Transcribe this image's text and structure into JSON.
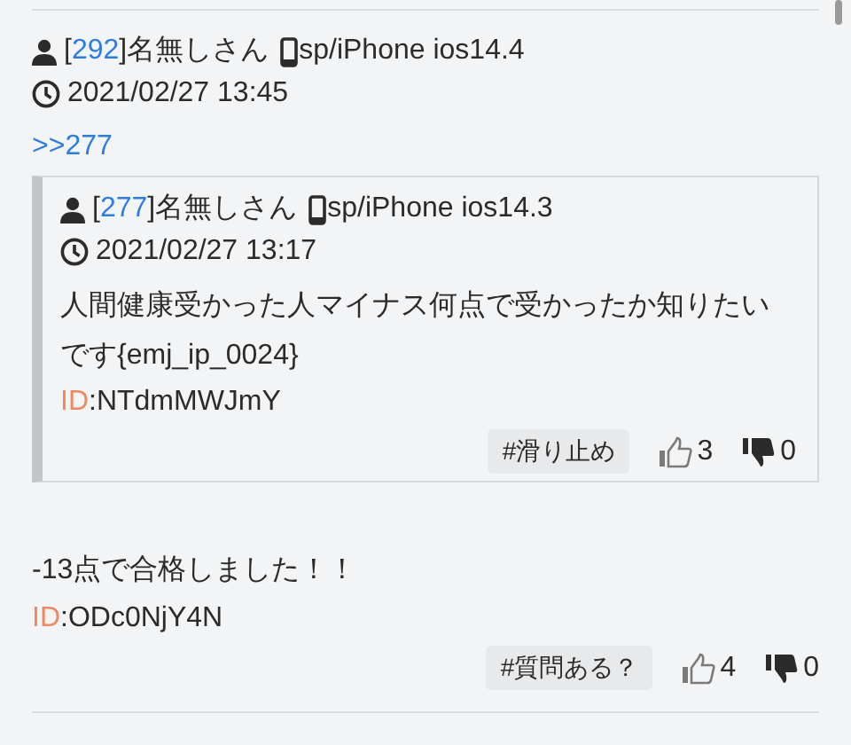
{
  "post": {
    "open": "[",
    "number": "292",
    "close": "]",
    "name": "名無しさん",
    "device": "sp/iPhone ios14.4",
    "time": "2021/02/27 13:45",
    "anchor": ">>277",
    "quote": {
      "open": "[",
      "number": "277",
      "close": "]",
      "name": "名無しさん",
      "device": "sp/iPhone ios14.3",
      "time": "2021/02/27 13:17",
      "body": "人間健康受かった人マイナス何点で受かったか知りたいです{emj_ip_0024}",
      "id_label": "ID",
      "id": ":NTdmMWJmY",
      "tag": "#滑り止め",
      "likes": "3",
      "dislikes": "0"
    },
    "body": "-13点で合格しました！！",
    "id_label": "ID",
    "id": ":ODc0NjY4N",
    "tag": "#質問ある？",
    "likes": "4",
    "dislikes": "0"
  }
}
